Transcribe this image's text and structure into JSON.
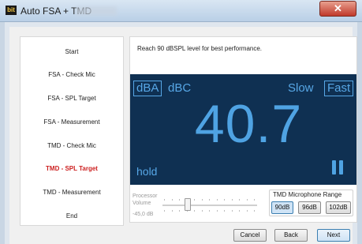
{
  "window": {
    "title": "Auto FSA + TMD",
    "app_icon": "bit",
    "close_glyph": "✕"
  },
  "steps": [
    {
      "label": "Start",
      "active": false
    },
    {
      "label": "FSA - Check Mic",
      "active": false
    },
    {
      "label": "FSA - SPL Target",
      "active": false
    },
    {
      "label": "FSA - Measurement",
      "active": false
    },
    {
      "label": "TMD - Check Mic",
      "active": false
    },
    {
      "label": "TMD - SPL Target",
      "active": true
    },
    {
      "label": "TMD - Measurement",
      "active": false
    },
    {
      "label": "End",
      "active": false
    }
  ],
  "hint": "Reach 90 dBSPL level for best performance.",
  "meter": {
    "weighting_a": "dBA",
    "weighting_c": "dBC",
    "speed_slow": "Slow",
    "speed_fast": "Fast",
    "reading": "40.7",
    "hold": "hold"
  },
  "processor_volume": {
    "label_line1": "Processor",
    "label_line2": "Volume",
    "value": "-45,0 dB"
  },
  "tmd_range": {
    "title": "TMD Microphone Range",
    "options": [
      "90dB",
      "96dB",
      "102dB"
    ],
    "selected": "90dB"
  },
  "buttons": {
    "cancel": "Cancel",
    "back": "Back",
    "next": "Next"
  },
  "colors": {
    "meter_background": "#0f3052",
    "meter_accent": "#4fa3e3",
    "active_step": "#cc1f1f"
  }
}
